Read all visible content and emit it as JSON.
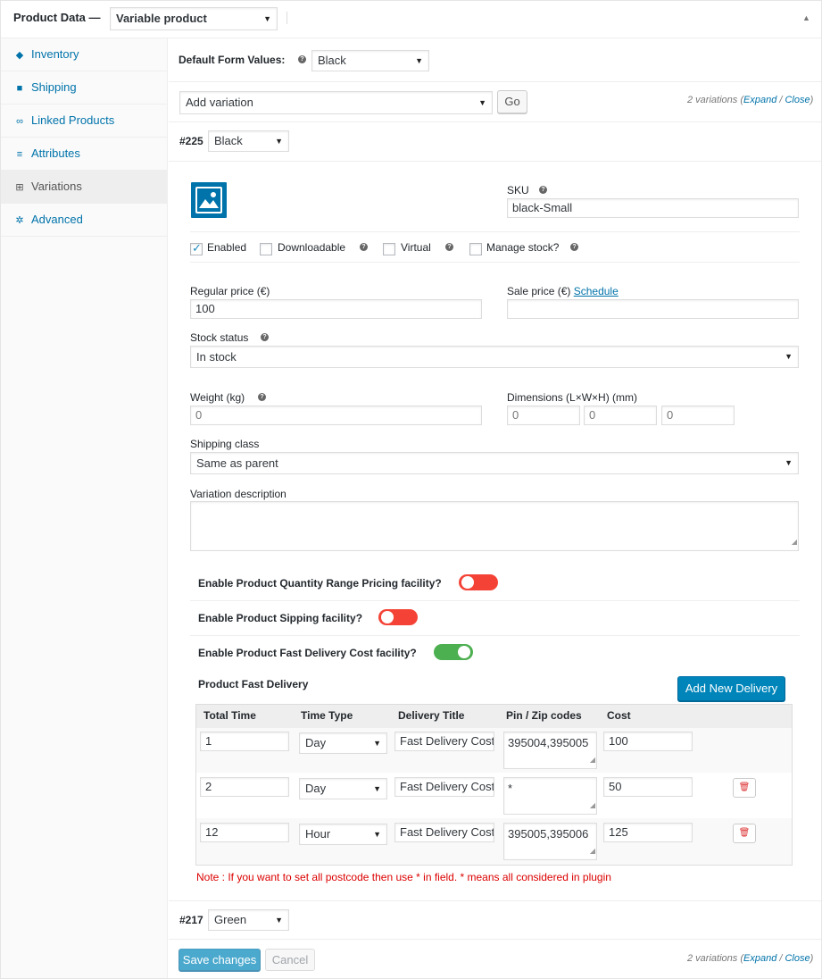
{
  "header": {
    "title": "Product Data —",
    "product_type": "Variable product"
  },
  "sidebar": {
    "items": [
      {
        "label": "Inventory",
        "icon": "◆"
      },
      {
        "label": "Shipping",
        "icon": "■"
      },
      {
        "label": "Linked Products",
        "icon": "∞"
      },
      {
        "label": "Attributes",
        "icon": "≡"
      },
      {
        "label": "Variations",
        "icon": "⊞"
      },
      {
        "label": "Advanced",
        "icon": "✲"
      }
    ]
  },
  "defaults": {
    "label": "Default Form Values:",
    "value": "Black"
  },
  "toolbar": {
    "action": "Add variation",
    "go": "Go",
    "count_text": "2 variations",
    "expand": "Expand",
    "sep": " / ",
    "close": "Close"
  },
  "variation1": {
    "id": "#225",
    "attribute": "Black",
    "sku_label": "SKU",
    "sku": "black-Small",
    "enabled": "Enabled",
    "downloadable": "Downloadable",
    "virtual": "Virtual",
    "manage_stock": "Manage stock?",
    "regular_price_label": "Regular price (€)",
    "regular_price": "100",
    "sale_price_label": "Sale price (€)",
    "schedule": "Schedule",
    "sale_price": "",
    "stock_status_label": "Stock status",
    "stock_status": "In stock",
    "weight_label": "Weight (kg)",
    "weight": "0",
    "dimensions_label": "Dimensions (L×W×H) (mm)",
    "length": "0",
    "width": "0",
    "height": "0",
    "shipping_class_label": "Shipping class",
    "shipping_class": "Same as parent",
    "description_label": "Variation description",
    "description": ""
  },
  "plugin": {
    "qty_range_label": "Enable Product Quantity Range Pricing facility?",
    "shipping_label": "Enable Product Sipping facility?",
    "fast_delivery_label": "Enable Product Fast Delivery Cost facility?",
    "section_title": "Product Fast Delivery",
    "add_button": "Add New Delivery",
    "columns": [
      "Total Time",
      "Time Type",
      "Delivery Title",
      "Pin / Zip codes",
      "Cost"
    ],
    "rows": [
      {
        "time": "1",
        "type": "Day",
        "title": "Fast Delivery Cost",
        "pins": "395004,395005",
        "cost": "100"
      },
      {
        "time": "2",
        "type": "Day",
        "title": "Fast Delivery Cost",
        "pins": "*",
        "cost": "50"
      },
      {
        "time": "12",
        "type": "Hour",
        "title": "Fast Delivery Cost",
        "pins": "395005,395006",
        "cost": "125"
      }
    ],
    "note": "Note : If you want to set all postcode then use * in field. * means all considered in plugin"
  },
  "variation2": {
    "id": "#217",
    "attribute": "Green"
  },
  "footer": {
    "save": "Save changes",
    "cancel": "Cancel",
    "count_text": "2 variations",
    "expand": "Expand",
    "sep": " / ",
    "close": "Close"
  },
  "colors": {
    "link": "#0073aa",
    "primary": "#0085ba",
    "toggle_off": "#f44336",
    "toggle_on": "#4caf50",
    "note": "#dc0000"
  }
}
